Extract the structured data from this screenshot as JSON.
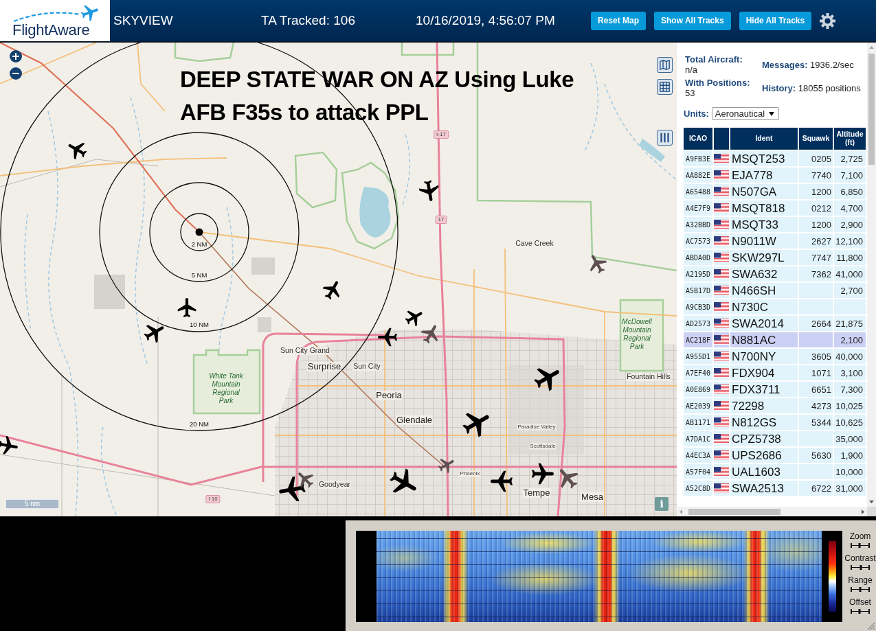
{
  "header": {
    "logo": "FlightAware",
    "title": "SKYVIEW",
    "tracked": "TA Tracked: 106",
    "datetime": "10/16/2019, 4:56:07 PM",
    "buttons": [
      "Reset Map",
      "Show All Tracks",
      "Hide All Tracks"
    ]
  },
  "map": {
    "caption": "DEEP STATE WAR ON AZ Using Luke AFB F35s to attack PPL",
    "range_rings": [
      "2 NM",
      "5 NM",
      "10 NM",
      "20 NM"
    ],
    "places": [
      {
        "name": "Cave Creek",
        "kind": "town"
      },
      {
        "name": "Sun City Grand",
        "kind": "town"
      },
      {
        "name": "Surprise",
        "kind": "city"
      },
      {
        "name": "Sun City",
        "kind": "town"
      },
      {
        "name": "Peoria",
        "kind": "city"
      },
      {
        "name": "Glendale",
        "kind": "city"
      },
      {
        "name": "White Tank Mountain Regional Park",
        "kind": "park"
      },
      {
        "name": "McDowell Mountain Regional Park",
        "kind": "park"
      },
      {
        "name": "Fountain Hills",
        "kind": "town"
      },
      {
        "name": "Paradise Valley",
        "kind": "small"
      },
      {
        "name": "Scottsdale",
        "kind": "small"
      },
      {
        "name": "Phoenix",
        "kind": "small"
      },
      {
        "name": "Goodyear",
        "kind": "town"
      },
      {
        "name": "Tempe",
        "kind": "city"
      },
      {
        "name": "Mesa",
        "kind": "city"
      }
    ],
    "road_shields": [
      "I-17",
      "17",
      "I 10"
    ],
    "aircraft": [
      {
        "color": "#000000"
      },
      {
        "color": "#000000"
      },
      {
        "color": "#5e5050"
      },
      {
        "color": "#000000"
      },
      {
        "color": "#000000"
      },
      {
        "color": "#000000"
      },
      {
        "color": "#000000"
      },
      {
        "color": "#5e5050"
      },
      {
        "color": "#000000"
      },
      {
        "color": "#000000"
      },
      {
        "color": "#000000"
      },
      {
        "color": "#000000"
      },
      {
        "color": "#000000"
      },
      {
        "color": "#5e5050"
      },
      {
        "color": "#000000"
      },
      {
        "color": "#5e5050"
      },
      {
        "color": "#000000"
      },
      {
        "color": "#000000"
      },
      {
        "color": "#5e5050"
      }
    ],
    "scale": "5 nm",
    "info_button": "i"
  },
  "panel": {
    "stats": [
      {
        "label": "Total Aircraft:",
        "value": "n/a"
      },
      {
        "label": "Messages:",
        "value": "1936.2/sec"
      },
      {
        "label": "With Positions:",
        "value": "53"
      },
      {
        "label": "History:",
        "value": "18055 positions"
      }
    ],
    "units": {
      "label": "Units:",
      "value": "Aeronautical"
    },
    "table": {
      "columns": [
        "ICAO",
        "Ident",
        "Squawk",
        "Altitude (ft)"
      ],
      "rows": [
        {
          "icao": "A9FB3E",
          "ident": "MSQT253",
          "squawk": "0205",
          "altitude": "2,725",
          "selected": false
        },
        {
          "icao": "AA882E",
          "ident": "EJA778",
          "squawk": "7740",
          "altitude": "7,100",
          "selected": false
        },
        {
          "icao": "A65488",
          "ident": "N507GA",
          "squawk": "1200",
          "altitude": "6,850",
          "selected": false
        },
        {
          "icao": "A4E7F9",
          "ident": "MSQT818",
          "squawk": "0212",
          "altitude": "4,700",
          "selected": false
        },
        {
          "icao": "A32BBD",
          "ident": "MSQT33",
          "squawk": "1200",
          "altitude": "2,900",
          "selected": false
        },
        {
          "icao": "AC7573",
          "ident": "N9011W",
          "squawk": "2627",
          "altitude": "12,100",
          "selected": false
        },
        {
          "icao": "ABDA0D",
          "ident": "SKW297L",
          "squawk": "7747",
          "altitude": "11,800",
          "selected": false
        },
        {
          "icao": "A2195D",
          "ident": "SWA632",
          "squawk": "7362",
          "altitude": "41,000",
          "selected": false
        },
        {
          "icao": "A5B17D",
          "ident": "N466SH",
          "altitude": "2,700",
          "selected": false
        },
        {
          "icao": "A9CB3D",
          "ident": "N730C",
          "selected": false
        },
        {
          "icao": "AD2573",
          "ident": "SWA2014",
          "squawk": "2664",
          "altitude": "21,875",
          "selected": false
        },
        {
          "icao": "AC218F",
          "ident": "N881AC",
          "altitude": "2,100",
          "selected": true
        },
        {
          "icao": "A955D1",
          "ident": "N700NY",
          "squawk": "3605",
          "altitude": "40,000",
          "selected": false
        },
        {
          "icao": "A7EF40",
          "ident": "FDX904",
          "squawk": "1071",
          "altitude": "3,100",
          "selected": false
        },
        {
          "icao": "A0E869",
          "ident": "FDX3711",
          "squawk": "6651",
          "altitude": "7,300",
          "selected": false
        },
        {
          "icao": "AE2039",
          "ident": "72298",
          "squawk": "4273",
          "altitude": "10,025",
          "selected": false
        },
        {
          "icao": "AB1171",
          "ident": "N812GS",
          "squawk": "5344",
          "altitude": "10,625",
          "selected": false
        },
        {
          "icao": "A7DA1C",
          "ident": "CPZ5738",
          "altitude": "35,000",
          "selected": false
        },
        {
          "icao": "A4EC3A",
          "ident": "UPS2686",
          "squawk": "5630",
          "altitude": "1,900",
          "selected": false
        },
        {
          "icao": "A57F04",
          "ident": "UAL1603",
          "altitude": "10,000",
          "selected": false
        },
        {
          "icao": "A52C8D",
          "ident": "SWA2513",
          "squawk": "6722",
          "altitude": "31,000",
          "selected": false
        }
      ]
    }
  },
  "waterfall": {
    "controls": [
      {
        "label": "Zoom",
        "level": 0.45
      },
      {
        "label": "Contrast",
        "level": 0.55
      },
      {
        "label": "Range",
        "level": 0.5
      },
      {
        "label": "Offset",
        "level": 0.45
      }
    ]
  }
}
